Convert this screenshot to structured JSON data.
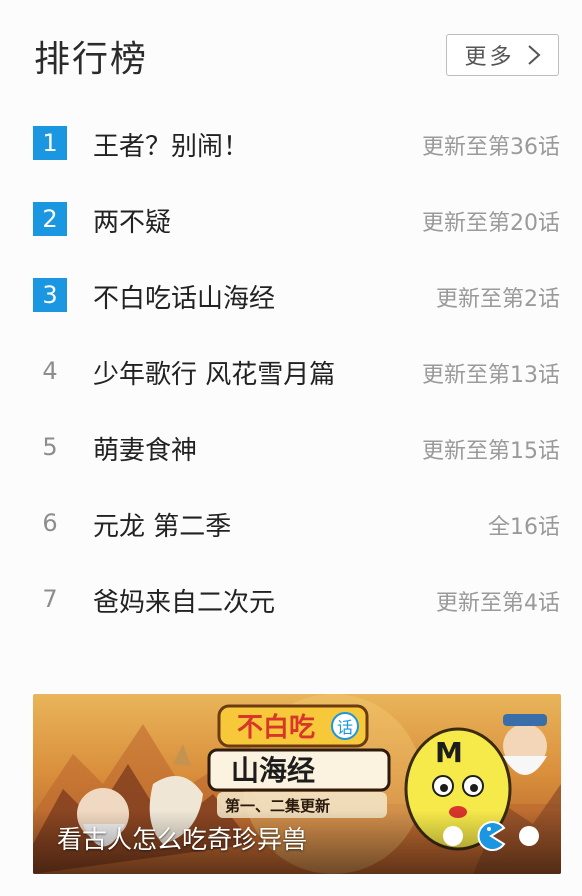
{
  "header": {
    "title": "排行榜",
    "more_label": "更多"
  },
  "ranking": [
    {
      "rank": "1",
      "name": "王者？别闹！",
      "status": "更新至第36话",
      "highlight": true
    },
    {
      "rank": "2",
      "name": "两不疑",
      "status": "更新至第20话",
      "highlight": true
    },
    {
      "rank": "3",
      "name": "不白吃话山海经",
      "status": "更新至第2话",
      "highlight": true
    },
    {
      "rank": "4",
      "name": "少年歌行 风花雪月篇",
      "status": "更新至第13话",
      "highlight": false
    },
    {
      "rank": "5",
      "name": "萌妻食神",
      "status": "更新至第15话",
      "highlight": false
    },
    {
      "rank": "6",
      "name": "元龙 第二季",
      "status": "全16话",
      "highlight": false
    },
    {
      "rank": "7",
      "name": "爸妈来自二次元",
      "status": "更新至第4话",
      "highlight": false
    }
  ],
  "banner": {
    "caption": "看古人怎么吃奇珍异兽",
    "logo_line1": "不白吃",
    "logo_badge": "话",
    "logo_line2": "山海经",
    "logo_sub": "第一、二集更新",
    "mascot_letter": "M",
    "pagination": {
      "count": 3,
      "active_index": 1
    }
  },
  "colors": {
    "accent": "#1b96e0",
    "rank_plain": "#8d8d8d",
    "status_text": "#9a9a9a",
    "title_text": "#2b2b2b"
  },
  "icons": {
    "more": "chevron-right-icon",
    "active_page": "pacman-indicator-icon"
  }
}
